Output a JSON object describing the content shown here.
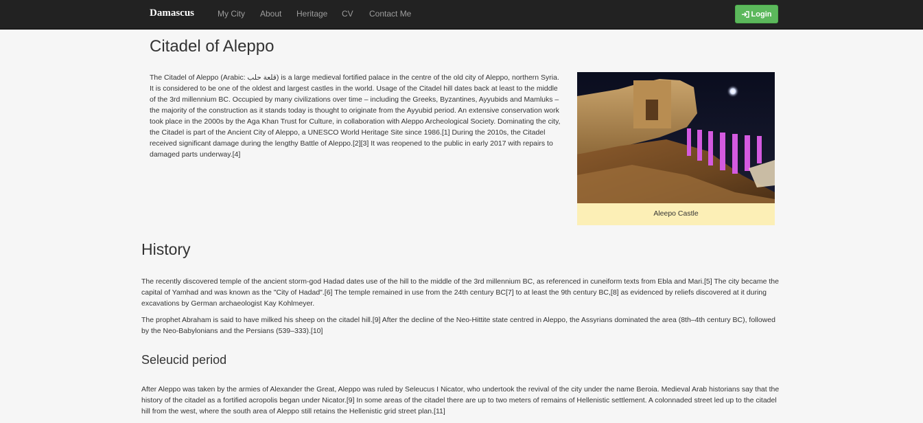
{
  "nav": {
    "brand": "Damascus",
    "links": [
      "My City",
      "About",
      "Heritage",
      "CV",
      "Contact Me"
    ],
    "login_label": "Login"
  },
  "page": {
    "title": "Citadel of Aleppo",
    "intro": "The Citadel of Aleppo (Arabic: قلعة حلب) is a large medieval fortified palace in the centre of the old city of Aleppo, northern Syria. It is considered to be one of the oldest and largest castles in the world. Usage of the Citadel hill dates back at least to the middle of the 3rd millennium BC. Occupied by many civilizations over time – including the Greeks, Byzantines, Ayyubids and Mamluks – the majority of the construction as it stands today is thought to originate from the Ayyubid period. An extensive conservation work took place in the 2000s by the Aga Khan Trust for Culture, in collaboration with Aleppo Archeological Society. Dominating the city, the Citadel is part of the Ancient City of Aleppo, a UNESCO World Heritage Site since 1986.[1] During the 2010s, the Citadel received significant damage during the lengthy Battle of Aleppo.[2][3] It was reopened to the public in early 2017 with repairs to damaged parts underway.[4]",
    "figure_caption": "Aleepo Castle"
  },
  "history": {
    "heading": "History",
    "p1": "The recently discovered temple of the ancient storm-god Hadad dates use of the hill to the middle of the 3rd millennium BC, as referenced in cuneiform texts from Ebla and Mari.[5] The city became the capital of Yamhad and was known as the \"City of Hadad\".[6] The temple remained in use from the 24th century BC[7] to at least the 9th century BC,[8] as evidenced by reliefs discovered at it during excavations by German archaeologist Kay Kohlmeyer.",
    "p2": "The prophet Abraham is said to have milked his sheep on the citadel hill.[9] After the decline of the Neo-Hittite state centred in Aleppo, the Assyrians dominated the area (8th–4th century BC), followed by the Neo-Babylonians and the Persians (539–333).[10]"
  },
  "seleucid": {
    "heading": "Seleucid period",
    "p1": "After Aleppo was taken by the armies of Alexander the Great, Aleppo was ruled by Seleucus I Nicator, who undertook the revival of the city under the name Beroia. Medieval Arab historians say that the history of the citadel as a fortified acropolis began under Nicator.[9] In some areas of the citadel there are up to two meters of remains of Hellenistic settlement. A colonnaded street led up to the citadel hill from the west, where the south area of Aleppo still retains the Hellenistic grid street plan.[11]"
  },
  "colors": {
    "navbar": "#222222",
    "nav_link": "#9d9d9d",
    "login": "#5cb85c",
    "caption_bg": "#fcefb6"
  },
  "icons": {
    "login": "login-icon"
  }
}
